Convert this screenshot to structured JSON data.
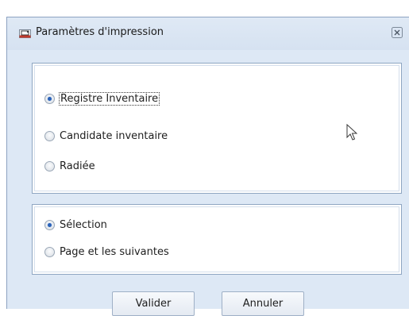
{
  "window": {
    "title": "Paramètres d'impression",
    "icon": "print-settings-icon",
    "close_icon": "close-icon"
  },
  "type_group": {
    "options": [
      {
        "label": "Registre Inventaire",
        "checked": true,
        "focused": true
      },
      {
        "label": "Candidate inventaire",
        "checked": false,
        "focused": false
      },
      {
        "label": "Radiée",
        "checked": false,
        "focused": false
      }
    ]
  },
  "range_group": {
    "options": [
      {
        "label": "Sélection",
        "checked": true,
        "focused": false
      },
      {
        "label": "Page et les suivantes",
        "checked": false,
        "focused": false
      }
    ]
  },
  "buttons": {
    "validate_label": "Valider",
    "cancel_label": "Annuler"
  },
  "colors": {
    "dialog_bg": "#dde8f5",
    "radio_selected": "#2a62b8",
    "group_border": "#8fa6c2"
  }
}
